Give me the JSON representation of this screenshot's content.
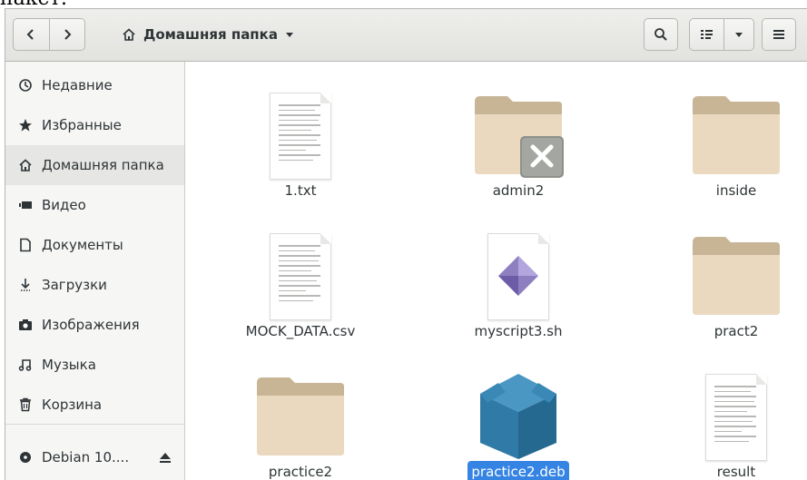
{
  "top_cutoff_text": "пакет:",
  "header": {
    "back_icon": "chevron-left-icon",
    "forward_icon": "chevron-right-icon",
    "location_icon": "home-icon",
    "location_label": "Домашняя папка",
    "location_menu_icon": "triangle-down-icon",
    "search_icon": "search-icon",
    "view_icon": "list-view-icon",
    "view_menu_icon": "triangle-down-icon",
    "menu_icon": "hamburger-menu-icon"
  },
  "sidebar": {
    "items": [
      {
        "label": "Недавние",
        "icon": "clock-icon",
        "active": false
      },
      {
        "label": "Избранные",
        "icon": "star-icon",
        "active": false
      },
      {
        "label": "Домашняя папка",
        "icon": "home-icon",
        "active": true
      },
      {
        "label": "Видео",
        "icon": "video-icon",
        "active": false
      },
      {
        "label": "Документы",
        "icon": "document-icon",
        "active": false
      },
      {
        "label": "Загрузки",
        "icon": "download-icon",
        "active": false
      },
      {
        "label": "Изображения",
        "icon": "camera-icon",
        "active": false
      },
      {
        "label": "Музыка",
        "icon": "music-icon",
        "active": false
      },
      {
        "label": "Корзина",
        "icon": "trash-icon",
        "active": false
      }
    ],
    "device": {
      "label": "Debian 10....",
      "icon": "disc-icon",
      "eject_icon": "eject-icon"
    }
  },
  "files": [
    {
      "name": "1.txt",
      "type": "text"
    },
    {
      "name": "admin2",
      "type": "folder-locked"
    },
    {
      "name": "inside",
      "type": "folder"
    },
    {
      "name": "MOCK_DATA.csv",
      "type": "text"
    },
    {
      "name": "myscript3.sh",
      "type": "script"
    },
    {
      "name": "pract2",
      "type": "folder"
    },
    {
      "name": "practice2",
      "type": "folder"
    },
    {
      "name": "practice2.deb",
      "type": "package",
      "selected": true
    },
    {
      "name": "result",
      "type": "text"
    }
  ],
  "colors": {
    "selection": "#3584e4",
    "folder": "#ebd9bf",
    "folder_tab": "#c8b596",
    "package": "#2f7aa6"
  }
}
